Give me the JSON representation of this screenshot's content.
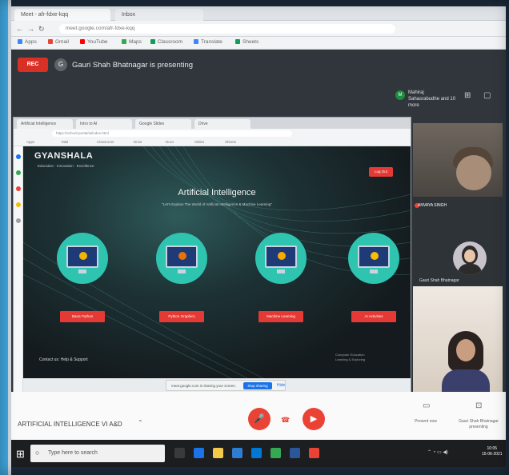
{
  "browser": {
    "tabs": [
      "Meet - afr-fdxe-kqq",
      "Inbox"
    ],
    "address": "meet.google.com/afr-fdxe-kqq",
    "bookmarks": [
      "Apps",
      "Gmail",
      "YouTube",
      "Maps",
      "Classroom",
      "Translate",
      "Sheets"
    ]
  },
  "meet": {
    "rec_label": "REC",
    "presenting_text": "Gauri Shah Bhatnagar is presenting",
    "owner_text": "Mahiraj Sahasrabudhe and 10 more",
    "meeting_title": "ARTIFICIAL INTELLIGENCE VI A&D",
    "present_now_label": "Present now",
    "presenter_label": "Gauri Shah Bhatnagar presenting",
    "sharing_text": "meet.google.com is sharing your screen.",
    "stop_sharing_label": "Stop sharing",
    "hide_label": "Hide"
  },
  "shared_page": {
    "tabs": [
      "Artificial Intelligence",
      "Intro to AI",
      "Google Slides",
      "Drive"
    ],
    "address": "https://school-portal/ai/index.html",
    "bookmarks": [
      "Apps",
      "Mail",
      "Classroom",
      "Drive",
      "Docs",
      "Slides",
      "Sheets"
    ],
    "logo": "GYANSHALA",
    "logo_sub": "Education · Innovation · Excellence",
    "logout_label": "Log Out",
    "title": "Artificial Intelligence",
    "subtitle": "\"Let's Explore The World of Artificial Intelligence & Machine Learning\"",
    "modules": [
      {
        "label": "Basic Python",
        "icon_color": "#f4b400"
      },
      {
        "label": "Python Graphics",
        "icon_color": "#e8710a"
      },
      {
        "label": "Machine Learning",
        "icon_color": "#f9ab00"
      },
      {
        "label": "AI Activities",
        "icon_color": "#fbbc04"
      }
    ],
    "contact": "Contact us: Help & Support",
    "footer_right": "Computer Education\nLearning & Exploring"
  },
  "participants": [
    {
      "name": "ANVAYA SINGH"
    },
    {
      "name": "Gauri Shah Bhatnagar"
    }
  ],
  "taskbar": {
    "search_placeholder": "Type here to search",
    "time": "10:05",
    "date": "15-06-2021"
  }
}
